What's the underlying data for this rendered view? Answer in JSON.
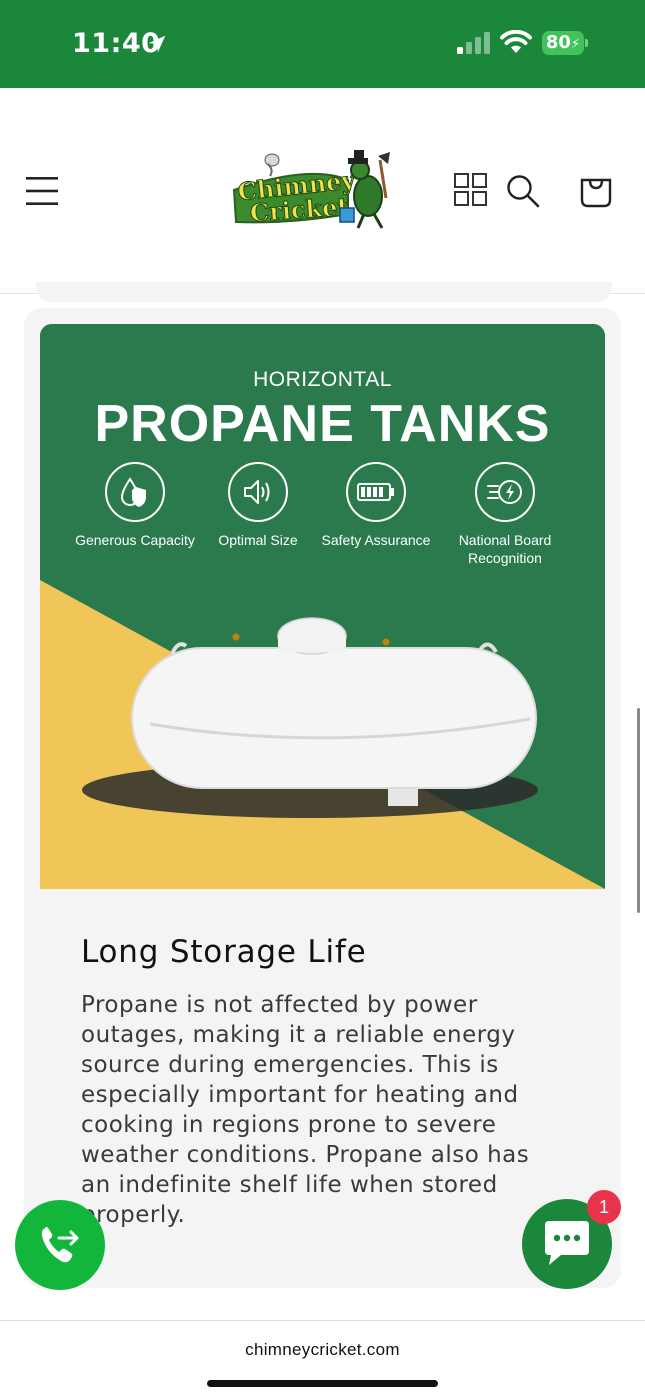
{
  "status_bar": {
    "time": "11:40",
    "battery_level": "80",
    "icons": [
      "location-arrow-icon",
      "cellular-signal-icon",
      "wifi-icon",
      "battery-charging-icon"
    ]
  },
  "header": {
    "logo": {
      "line1": "Chimney",
      "line2": "Cricket"
    },
    "icons": [
      "hamburger-menu-icon",
      "grid-icon",
      "search-icon",
      "shopping-bag-icon"
    ]
  },
  "banner": {
    "subtitle": "HORIZONTAL",
    "title": "PROPANE TANKS",
    "features": [
      {
        "label": "Generous Capacity",
        "icon": "droplet-shield-icon"
      },
      {
        "label": "Optimal Size",
        "icon": "speaker-volume-icon"
      },
      {
        "label": "Safety Assurance",
        "icon": "battery-full-icon"
      },
      {
        "label": "National Board Recognition",
        "icon": "speed-bolt-icon"
      }
    ],
    "colors": {
      "green": "#2a7a4d",
      "yellow": "#f1c659"
    }
  },
  "section": {
    "heading": "Long Storage Life",
    "body": "Propane is not affected by power outages, making it a reliable energy source during emergencies. This is especially important for heating and cooking in regions prone to severe weather conditions. Propane also has an indefinite shelf life when stored properly."
  },
  "floating": {
    "chat_badge_count": "1",
    "call_icon": "phone-forward-icon",
    "chat_icon": "chat-bubble-icon"
  },
  "browser": {
    "url": "chimneycricket.com"
  },
  "colors": {
    "brand_green": "#1b873a",
    "call_green": "#12b63a",
    "badge_red": "#e8334b"
  }
}
